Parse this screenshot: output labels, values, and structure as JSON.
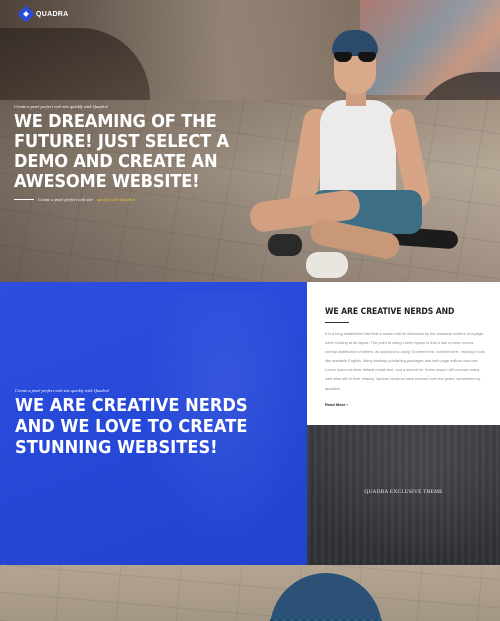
{
  "brand": {
    "name": "QUADRA",
    "accent": "#2a4de0"
  },
  "hero": {
    "kicker": "Create a pixel perfect web site quickly with Quadra!",
    "title": "We dreaming of the future! Just select a demo and create an awesome website!",
    "sub_prefix": "Create a pixel perfect web site",
    "sub_accent": "quickly with Quadra!",
    "sub_accent_color": "#e4c733"
  },
  "blue": {
    "kicker": "Create a pixel perfect web site quickly with Quadra!",
    "title": "We are creative nerds and we love to create stunning websites!",
    "background": "#2447d6"
  },
  "article": {
    "title": "We are creative nerds and",
    "body": "It is a long established fact that a reader will be distracted by the readable content of a page when looking at its layout. The point of using Lorem Ipsum is that it has a more-or-less normal distribution of letters, as opposed to using 'Content here, content here', making it look like readable English. Many desktop publishing packages and web page editors now use Lorem Ipsum as their default model text, and a search for 'lorem ipsum' will uncover many web sites still in their infancy. Various versions have evolved over the years, sometimes by accident.",
    "more_label": "Read More ›"
  },
  "crowd": {
    "label": "QUADRA EXCLUSIVE THEME"
  }
}
